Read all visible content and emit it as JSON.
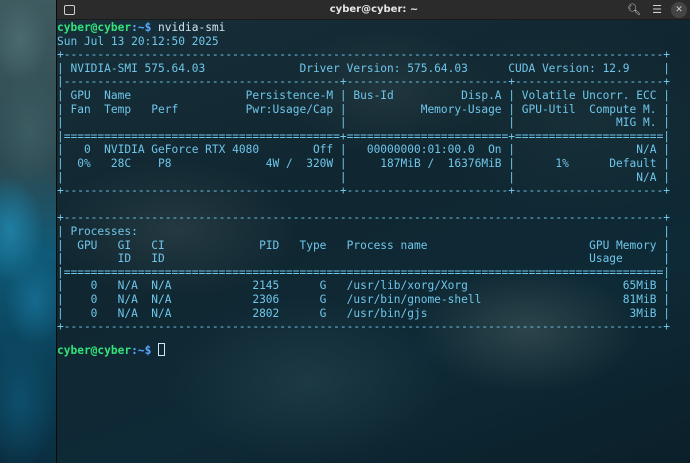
{
  "window": {
    "title": "cyber@cyber: ~"
  },
  "prompt": {
    "user_host": "cyber@cyber",
    "path": ":~$ ",
    "command": "nvidia-smi"
  },
  "output_lines": [
    "Sun Jul 13 20:12:50 2025",
    "+-----------------------------------------------------------------------------------------+",
    "| NVIDIA-SMI 575.64.03              Driver Version: 575.64.03      CUDA Version: 12.9     |",
    "|-----------------------------------------+------------------------+----------------------+",
    "| GPU  Name                 Persistence-M | Bus-Id          Disp.A | Volatile Uncorr. ECC |",
    "| Fan  Temp   Perf          Pwr:Usage/Cap |           Memory-Usage | GPU-Util  Compute M. |",
    "|                                         |                        |               MIG M. |",
    "|=========================================+========================+======================|",
    "|   0  NVIDIA GeForce RTX 4080        Off |   00000000:01:00.0  On |                  N/A |",
    "|  0%   28C    P8              4W /  320W |     187MiB /  16376MiB |      1%      Default |",
    "|                                         |                        |                  N/A |",
    "+-----------------------------------------+------------------------+----------------------+",
    "",
    "+-----------------------------------------------------------------------------------------+",
    "| Processes:                                                                              |",
    "|  GPU   GI   CI              PID   Type   Process name                        GPU Memory |",
    "|        ID   ID                                                               Usage      |",
    "|=========================================================================================|",
    "|    0   N/A  N/A            2145      G   /usr/lib/xorg/Xorg                       65MiB |",
    "|    0   N/A  N/A            2306      G   /usr/bin/gnome-shell                     81MiB |",
    "|    0   N/A  N/A            2802      G   /usr/bin/gjs                              3MiB |",
    "+-----------------------------------------------------------------------------------------+"
  ],
  "icons": {
    "new_tab": "terminal-new-tab-icon",
    "search": "search-icon",
    "menu": "hamburger-menu-icon",
    "close": "close-icon"
  },
  "colors": {
    "output": "#6fc6ea",
    "user_host": "#34e27a",
    "path": "#5aa8ff",
    "command": "#cfe6ee"
  }
}
